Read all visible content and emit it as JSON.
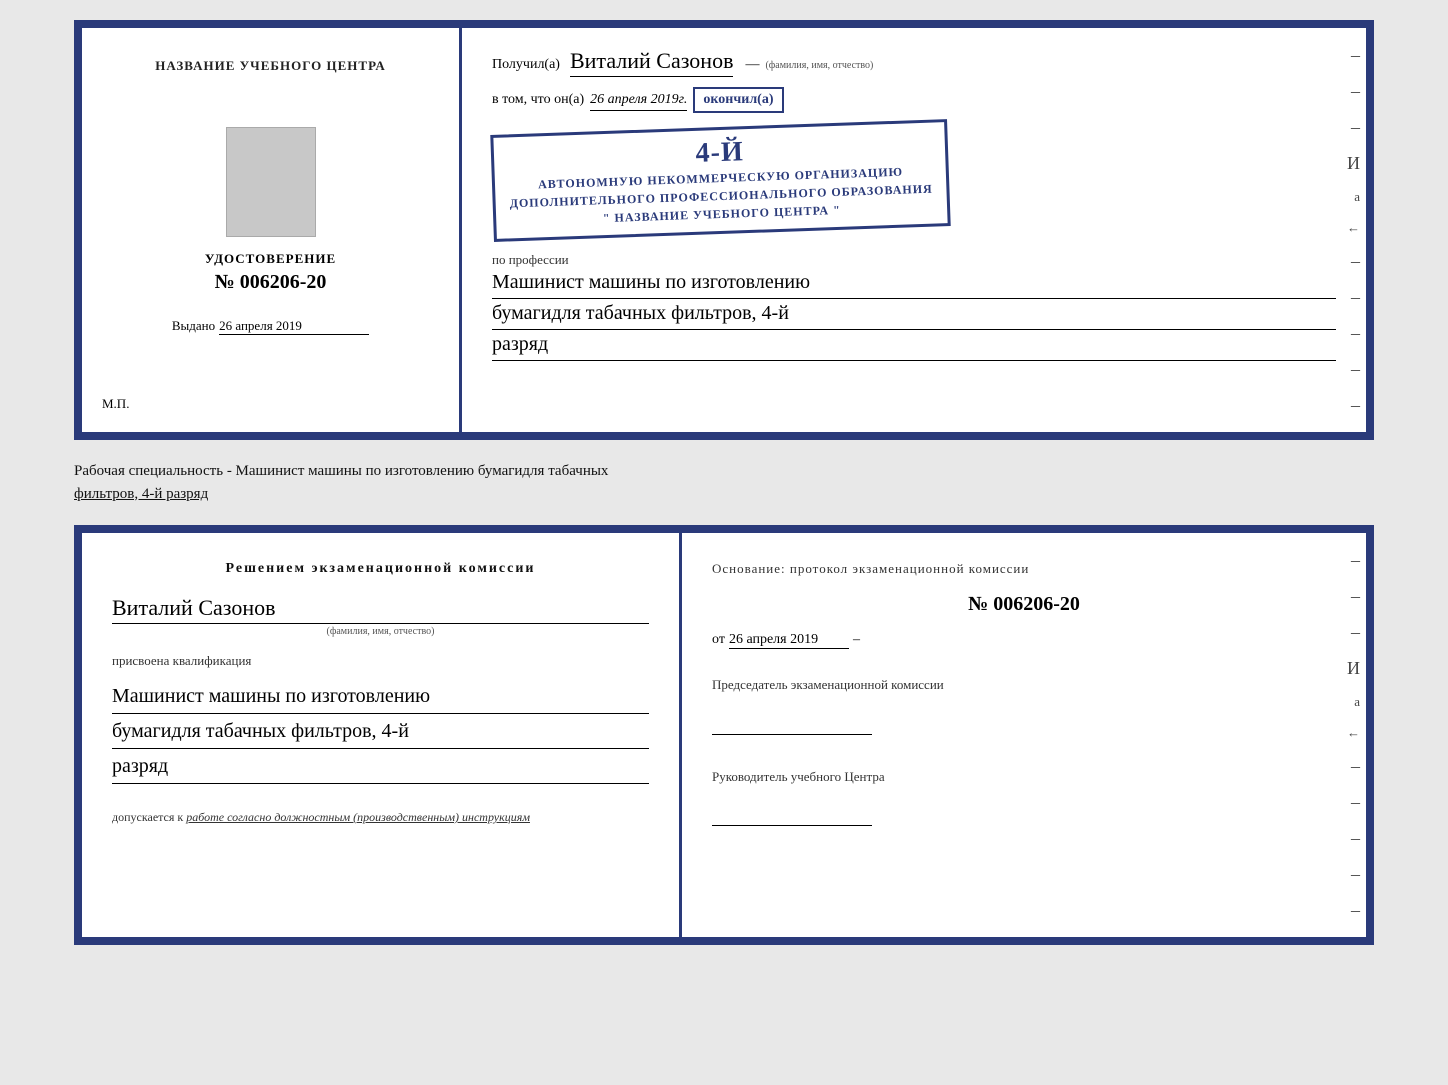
{
  "top_cert": {
    "left": {
      "org_name": "НАЗВАНИЕ УЧЕБНОГО ЦЕНТРА",
      "udost_label": "УДОСТОВЕРЕНИЕ",
      "udost_number": "№ 006206-20",
      "issued_label": "Выдано",
      "issued_date": "26 апреля 2019",
      "mp_label": "М.П."
    },
    "right": {
      "poluchil_label": "Получил(а)",
      "recipient_name": "Виталий Сазонов",
      "fio_hint": "(фамилия, имя, отчество)",
      "dash_line": "—",
      "vtom_label": "в том, что он(а)",
      "vtom_date": "26 апреля 2019г.",
      "okoncil_label": "окончил(а)",
      "stamp_num": "4-й",
      "stamp_line1": "АВТОНОМНУЮ НЕКОММЕРЧЕСКУЮ ОРГАНИЗАЦИЮ",
      "stamp_line2": "ДОПОЛНИТЕЛЬНОГО ПРОФЕССИОНАЛЬНОГО ОБРАЗОВАНИЯ",
      "stamp_line3": "\" НАЗВАНИЕ УЧЕБНОГО ЦЕНТРА \"",
      "profession_label": "по профессии",
      "profession_line1": "Машинист машины по изготовлению",
      "profession_line2": "бумагидля табачных фильтров, 4-й",
      "profession_line3": "разряд",
      "dashes": [
        "-",
        "-",
        "-",
        "И",
        "а",
        "←",
        "-",
        "-",
        "-",
        "-",
        "-"
      ]
    }
  },
  "cert_label": {
    "main": "Рабочая специальность - Машинист машины по изготовлению бумагидля табачных",
    "underline_part": "фильтров, 4-й разряд"
  },
  "bottom_cert": {
    "left": {
      "decision_title": "Решением  экзаменационной  комиссии",
      "person_name": "Виталий Сазонов",
      "fio_sub": "(фамилия, имя, отчество)",
      "prisvoena": "присвоена квалификация",
      "qual_line1": "Машинист машины по изготовлению",
      "qual_line2": "бумагидля табачных фильтров, 4-й",
      "qual_line3": "разряд",
      "dopusk_label": "допускается к",
      "dopusk_value": "работе согласно должностным (производственным) инструкциям"
    },
    "right": {
      "osnov_label": "Основание:  протокол  экзаменационной  комиссии",
      "protocol_num": "№  006206-20",
      "ot_label": "от",
      "ot_date": "26 апреля 2019",
      "chairman_label": "Председатель экзаменационной комиссии",
      "rukov_label": "Руководитель учебного Центра",
      "dashes": [
        "-",
        "-",
        "-",
        "И",
        "а",
        "←",
        "-",
        "-",
        "-",
        "-",
        "-"
      ]
    }
  }
}
